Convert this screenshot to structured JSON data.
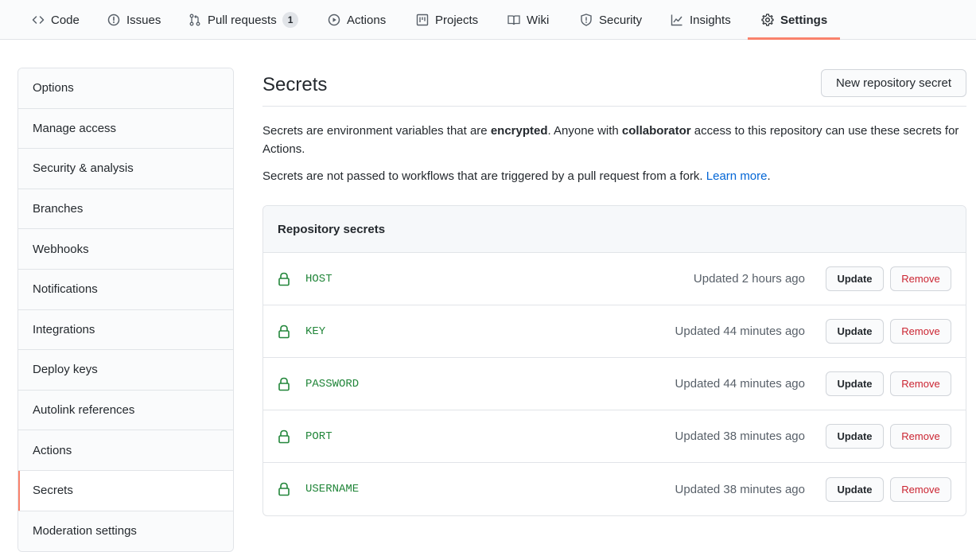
{
  "nav": {
    "tabs": [
      {
        "label": "Code",
        "icon": "code-icon"
      },
      {
        "label": "Issues",
        "icon": "issue-opened-icon"
      },
      {
        "label": "Pull requests",
        "icon": "git-pull-request-icon",
        "count": "1"
      },
      {
        "label": "Actions",
        "icon": "play-icon"
      },
      {
        "label": "Projects",
        "icon": "project-icon"
      },
      {
        "label": "Wiki",
        "icon": "book-icon"
      },
      {
        "label": "Security",
        "icon": "shield-icon"
      },
      {
        "label": "Insights",
        "icon": "graph-icon"
      },
      {
        "label": "Settings",
        "icon": "gear-icon",
        "selected": true
      }
    ]
  },
  "sidebar": {
    "items": [
      {
        "label": "Options"
      },
      {
        "label": "Manage access"
      },
      {
        "label": "Security & analysis"
      },
      {
        "label": "Branches"
      },
      {
        "label": "Webhooks"
      },
      {
        "label": "Notifications"
      },
      {
        "label": "Integrations"
      },
      {
        "label": "Deploy keys"
      },
      {
        "label": "Autolink references"
      },
      {
        "label": "Actions"
      },
      {
        "label": "Secrets",
        "selected": true
      },
      {
        "label": "Moderation settings"
      }
    ]
  },
  "main": {
    "title": "Secrets",
    "new_button": "New repository secret",
    "desc1": {
      "p1": "Secrets are environment variables that are ",
      "b1": "encrypted",
      "p2": ". Anyone with ",
      "b2": "collaborator",
      "p3": " access to this repository can use these secrets for Actions."
    },
    "desc2": {
      "text": "Secrets are not passed to workflows that are triggered by a pull request from a fork. ",
      "link": "Learn more",
      "end": "."
    },
    "box_title": "Repository secrets",
    "update_label": "Update",
    "remove_label": "Remove",
    "secrets": [
      {
        "name": "HOST",
        "updated": "Updated 2 hours ago"
      },
      {
        "name": "KEY",
        "updated": "Updated 44 minutes ago"
      },
      {
        "name": "PASSWORD",
        "updated": "Updated 44 minutes ago"
      },
      {
        "name": "PORT",
        "updated": "Updated 38 minutes ago"
      },
      {
        "name": "USERNAME",
        "updated": "Updated 38 minutes ago"
      }
    ]
  },
  "colors": {
    "accent_underline": "#f9826c",
    "secret_name": "#22863a",
    "remove_text": "#cb2431",
    "link": "#0366d6"
  }
}
